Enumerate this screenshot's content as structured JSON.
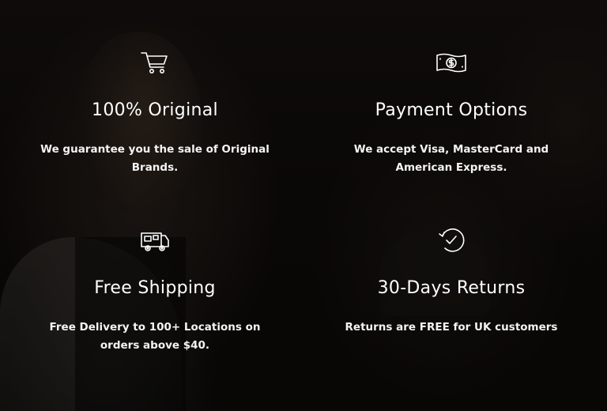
{
  "colors": {
    "text": "#ffffff",
    "background": "#0c0a09"
  },
  "features": [
    {
      "icon": "shopping-cart-icon",
      "title": "100% Original",
      "description": "We guarantee you the sale of Original Brands."
    },
    {
      "icon": "banknote-dollar-icon",
      "title": "Payment Options",
      "description": "We accept Visa, MasterCard and American Express."
    },
    {
      "icon": "delivery-truck-icon",
      "title": "Free Shipping",
      "description": "Free Delivery to 100+ Locations on orders above $40."
    },
    {
      "icon": "return-check-icon",
      "title": "30-Days Returns",
      "description": "Returns are FREE for UK customers"
    }
  ]
}
